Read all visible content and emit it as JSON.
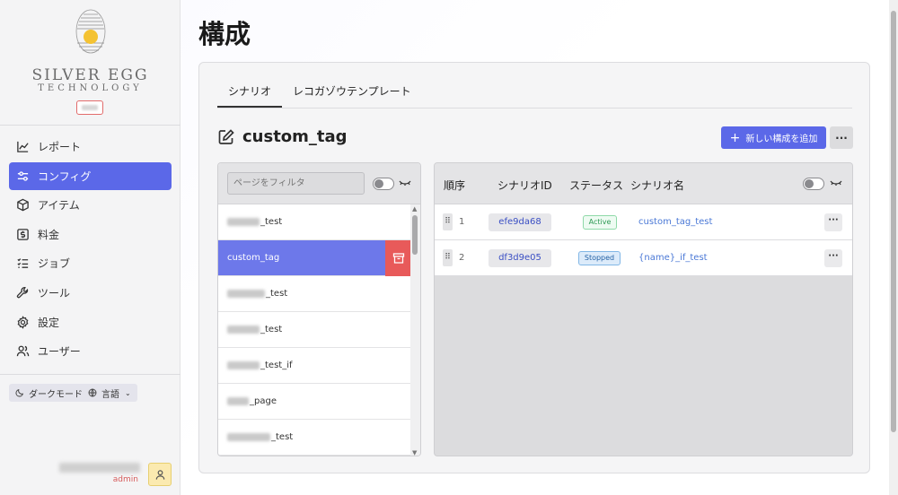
{
  "brand": {
    "line1": "SILVER EGG",
    "line2": "TECHNOLOGY"
  },
  "sidebar": {
    "items": [
      {
        "label": "レポート",
        "icon": "chart-line-icon"
      },
      {
        "label": "コンフィグ",
        "icon": "sliders-icon",
        "active": true
      },
      {
        "label": "アイテム",
        "icon": "box-icon"
      },
      {
        "label": "料金",
        "icon": "dollar-icon"
      },
      {
        "label": "ジョブ",
        "icon": "list-check-icon"
      },
      {
        "label": "ツール",
        "icon": "wrench-icon"
      },
      {
        "label": "設定",
        "icon": "gear-icon"
      },
      {
        "label": "ユーザー",
        "icon": "users-icon"
      }
    ],
    "dark_mode_label": "ダークモード",
    "language_label": "言語",
    "user_role": "admin"
  },
  "page": {
    "title": "構成",
    "tabs": [
      {
        "label": "シナリオ",
        "active": true
      },
      {
        "label": "レコガゾウテンプレート",
        "active": false
      }
    ],
    "scenario_name": "custom_tag",
    "add_button_label": "新しい構成を追加",
    "more_label": "···"
  },
  "list": {
    "filter_placeholder": "ページをフィルタ",
    "items": [
      {
        "suffix": "_test"
      },
      {
        "suffix": "custom_tag",
        "selected": true
      },
      {
        "suffix": "_test"
      },
      {
        "suffix": "_test"
      },
      {
        "suffix": "_test_if"
      },
      {
        "suffix": "_page"
      },
      {
        "suffix": "_test"
      }
    ]
  },
  "table": {
    "columns": [
      "順序",
      "シナリオID",
      "ステータス",
      "シナリオ名"
    ],
    "rows": [
      {
        "order": "1",
        "id": "efe9da68",
        "status": "Active",
        "name": "custom_tag_test"
      },
      {
        "order": "2",
        "id": "df3d9e05",
        "status": "Stopped",
        "name": "{name}_if_test"
      }
    ]
  },
  "colors": {
    "accent": "#5b68e8",
    "danger": "#e85a5a",
    "active_status": "#2f9a55",
    "stopped_status": "#2563a6"
  }
}
